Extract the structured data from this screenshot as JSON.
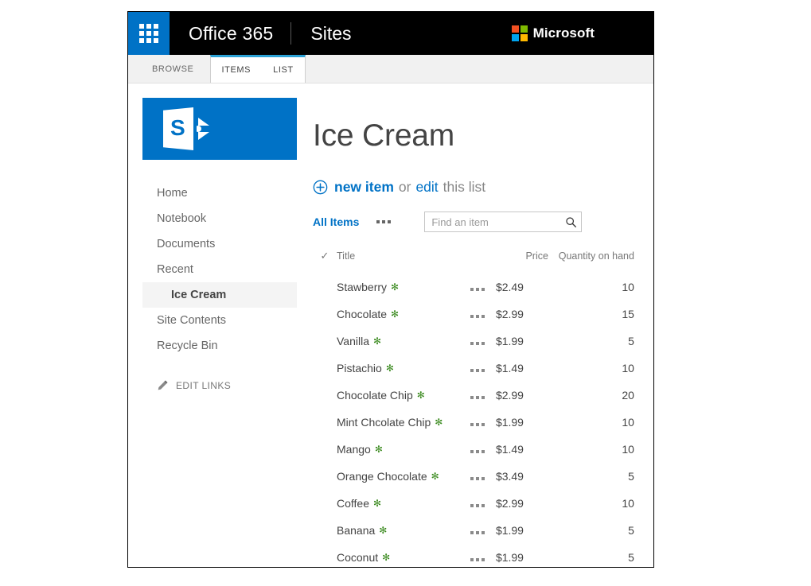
{
  "suitebar": {
    "app_launcher": "app-launcher-waffle",
    "brand": "Office 365",
    "app_name": "Sites",
    "microsoft_label": "Microsoft",
    "brand_bg": "#000000",
    "waffle_bg": "#0072c6",
    "ms_colors": [
      "#f25022",
      "#7fba00",
      "#00a4ef",
      "#ffb900"
    ]
  },
  "ribbon": {
    "browse_tab": "BROWSE",
    "items_tab": "ITEMS",
    "list_tab": "LIST",
    "active_accent": "#2ba2d6"
  },
  "sidebar": {
    "logo_letter": "S",
    "items": [
      {
        "label": "Home",
        "selected": false,
        "sub": false
      },
      {
        "label": "Notebook",
        "selected": false,
        "sub": false
      },
      {
        "label": "Documents",
        "selected": false,
        "sub": false
      },
      {
        "label": "Recent",
        "selected": false,
        "sub": false
      },
      {
        "label": "Ice Cream",
        "selected": true,
        "sub": true
      },
      {
        "label": "Site Contents",
        "selected": false,
        "sub": false
      },
      {
        "label": "Recycle Bin",
        "selected": false,
        "sub": false
      }
    ],
    "edit_links": "EDIT LINKS"
  },
  "main": {
    "title": "Ice Cream",
    "command": {
      "new_item": "new item",
      "or": "or",
      "edit": "edit",
      "tail": "this list"
    },
    "view_name": "All Items",
    "search": {
      "placeholder": "Find an item",
      "value": ""
    },
    "table": {
      "columns": [
        "Title",
        "Price",
        "Quantity on hand"
      ],
      "new_badge": "✻",
      "rows": [
        {
          "title": "Stawberry",
          "price": "$2.49",
          "qty": "10"
        },
        {
          "title": "Chocolate",
          "price": "$2.99",
          "qty": "15"
        },
        {
          "title": "Vanilla",
          "price": "$1.99",
          "qty": "5"
        },
        {
          "title": "Pistachio",
          "price": "$1.49",
          "qty": "10"
        },
        {
          "title": "Chocolate Chip",
          "price": "$2.99",
          "qty": "20"
        },
        {
          "title": "Mint Chcolate Chip",
          "price": "$1.99",
          "qty": "10"
        },
        {
          "title": "Mango",
          "price": "$1.49",
          "qty": "10"
        },
        {
          "title": "Orange Chocolate",
          "price": "$3.49",
          "qty": "5"
        },
        {
          "title": "Coffee",
          "price": "$2.99",
          "qty": "10"
        },
        {
          "title": "Banana",
          "price": "$1.99",
          "qty": "5"
        },
        {
          "title": "Coconut",
          "price": "$1.99",
          "qty": "5"
        }
      ]
    }
  }
}
